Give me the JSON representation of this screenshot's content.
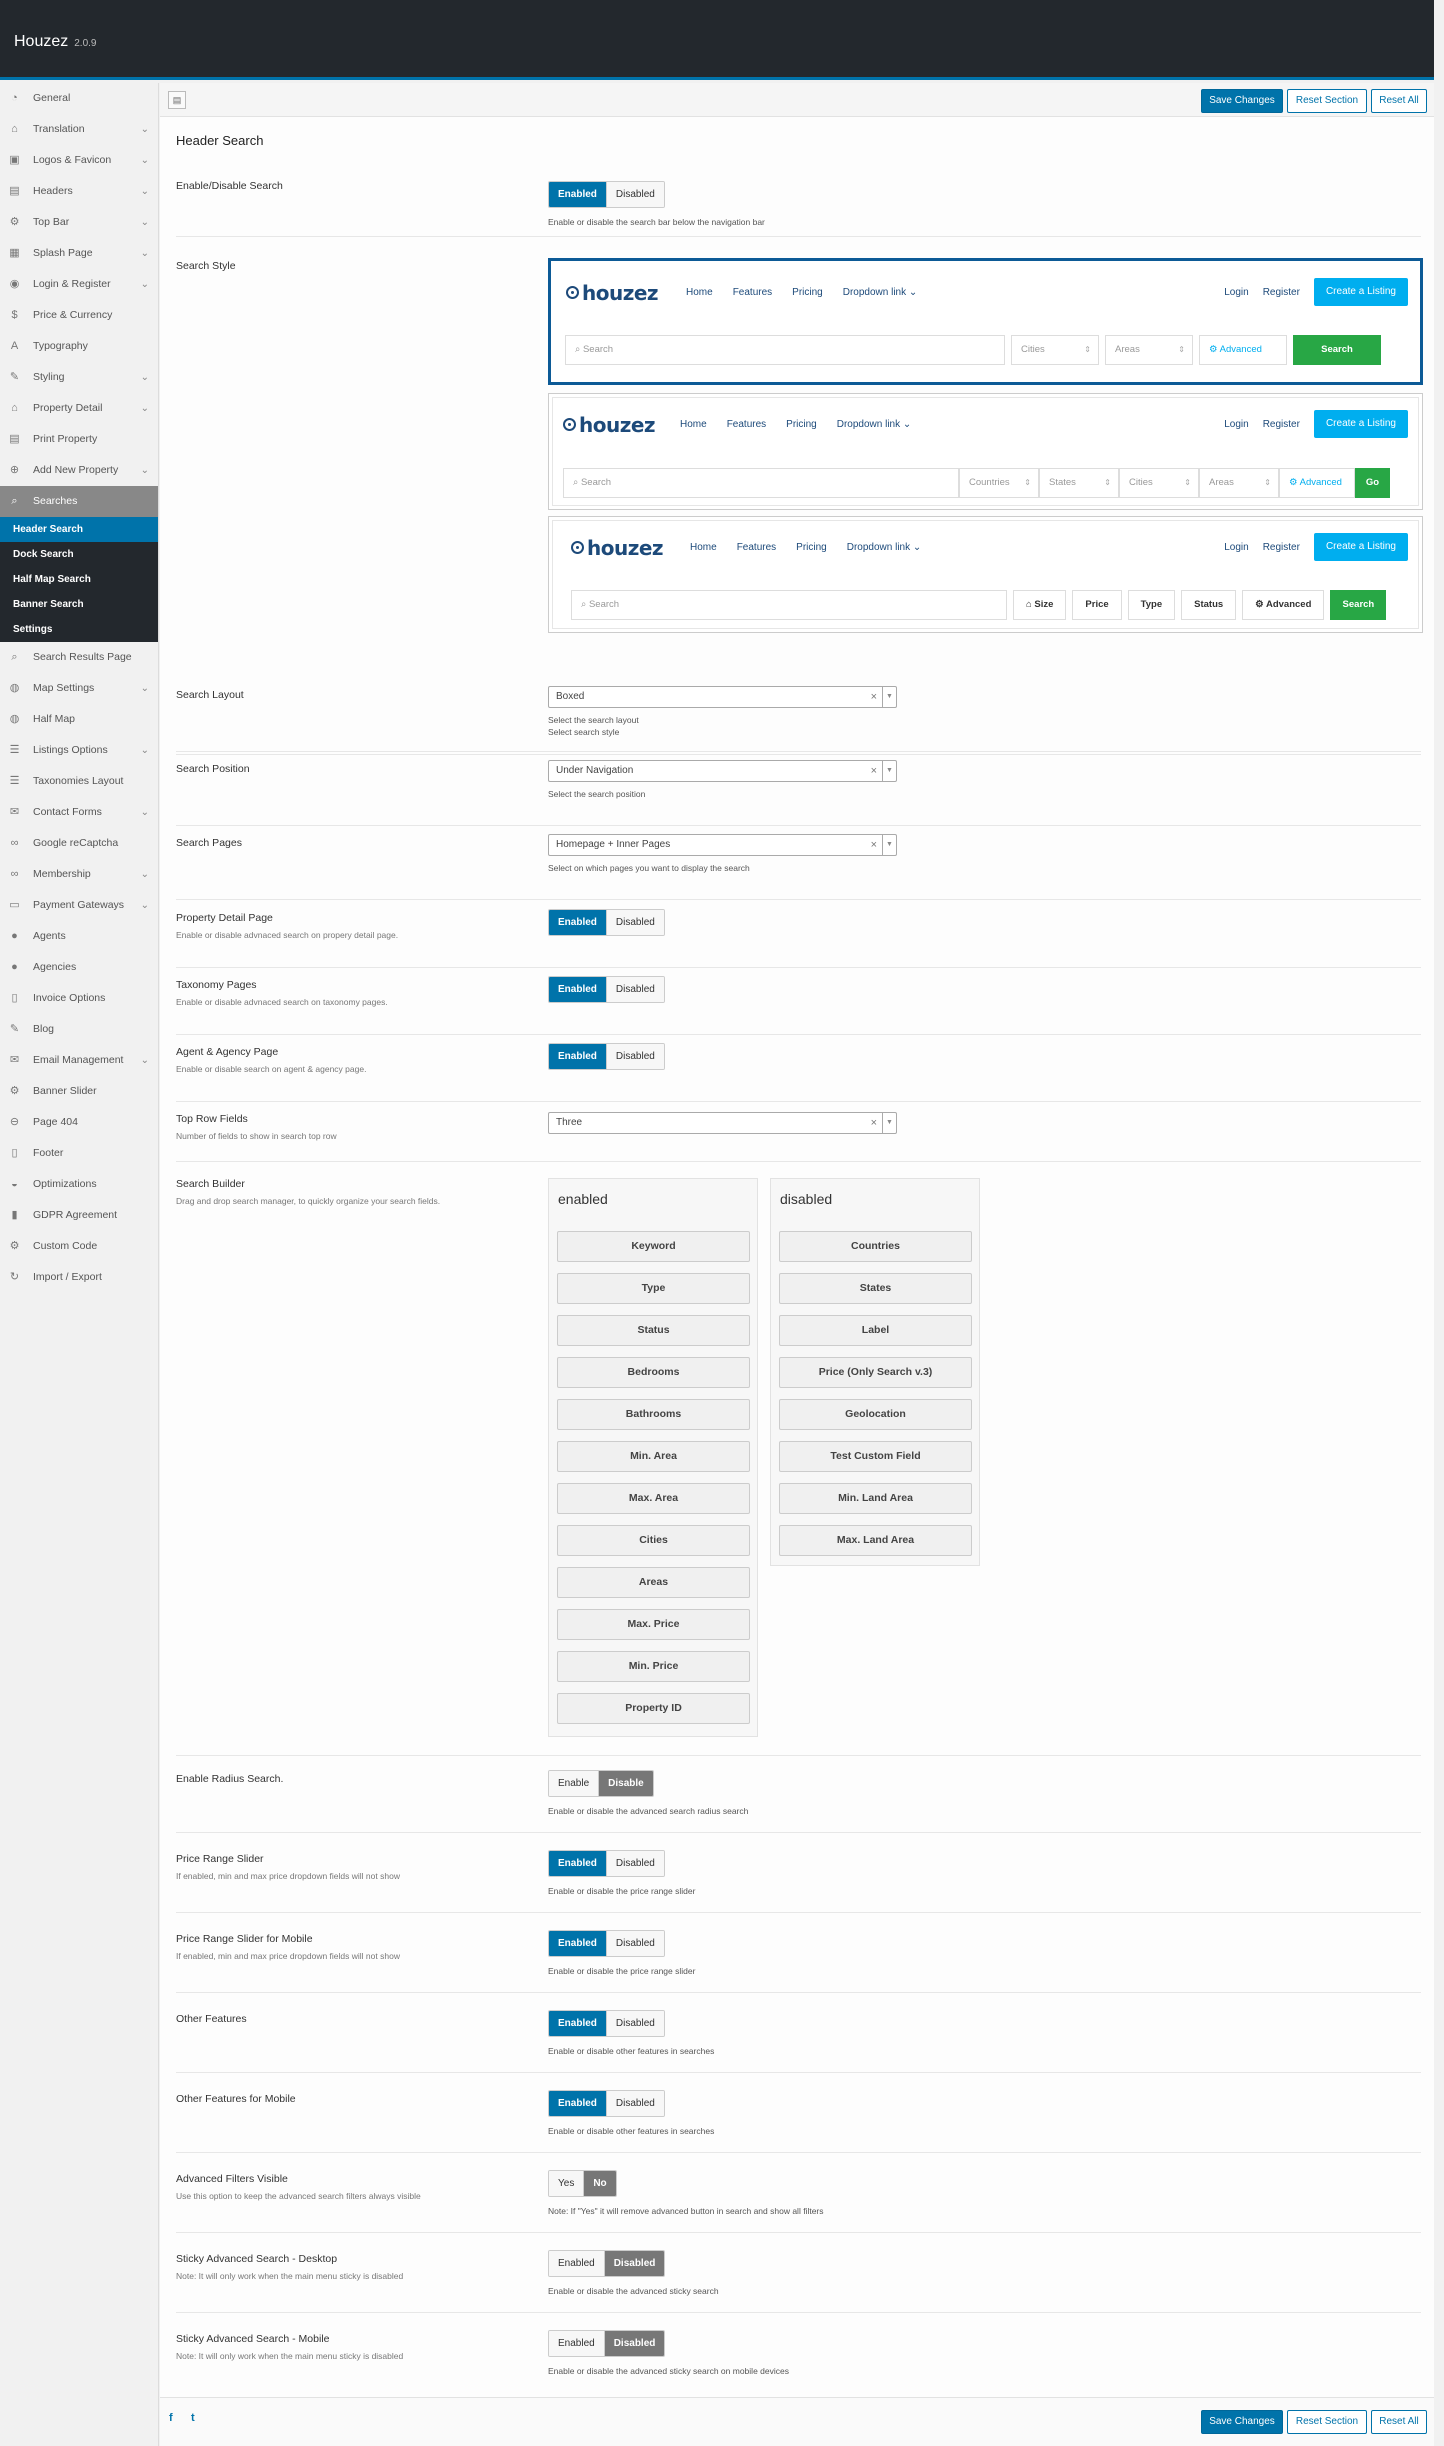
{
  "app": {
    "name": "Houzez",
    "version": "2.0.9"
  },
  "actions": {
    "save": "Save Changes",
    "reset_section": "Reset Section",
    "reset_all": "Reset All"
  },
  "sidebar": {
    "items": [
      {
        "label": "General",
        "icon": "dashboard-icon",
        "chev": false
      },
      {
        "label": "Translation",
        "icon": "home-icon",
        "chev": true
      },
      {
        "label": "Logos & Favicon",
        "icon": "image-icon",
        "chev": true
      },
      {
        "label": "Headers",
        "icon": "header-icon",
        "chev": true
      },
      {
        "label": "Top Bar",
        "icon": "gear-icon",
        "chev": true
      },
      {
        "label": "Splash Page",
        "icon": "layout-icon",
        "chev": true
      },
      {
        "label": "Login & Register",
        "icon": "user-circle-icon",
        "chev": true
      },
      {
        "label": "Price & Currency",
        "icon": "dollar-icon",
        "chev": false
      },
      {
        "label": "Typography",
        "icon": "font-icon",
        "chev": false
      },
      {
        "label": "Styling",
        "icon": "brush-icon",
        "chev": true
      },
      {
        "label": "Property Detail",
        "icon": "home-icon",
        "chev": true
      },
      {
        "label": "Print Property",
        "icon": "print-icon",
        "chev": false
      },
      {
        "label": "Add New Property",
        "icon": "plus-circle-icon",
        "chev": true
      },
      {
        "label": "Searches",
        "icon": "search-icon",
        "chev": false,
        "active": true
      }
    ],
    "sub_items": [
      "Header Search",
      "Dock Search",
      "Half Map Search",
      "Banner Search",
      "Settings"
    ],
    "items_after": [
      {
        "label": "Search Results Page",
        "icon": "search-icon",
        "chev": false
      },
      {
        "label": "Map Settings",
        "icon": "globe-icon",
        "chev": true
      },
      {
        "label": "Half Map",
        "icon": "globe-icon",
        "chev": false
      },
      {
        "label": "Listings Options",
        "icon": "list-icon",
        "chev": true
      },
      {
        "label": "Taxonomies Layout",
        "icon": "list-icon",
        "chev": false
      },
      {
        "label": "Contact Forms",
        "icon": "envelope-icon",
        "chev": true
      },
      {
        "label": "Google reCaptcha",
        "icon": "link-icon",
        "chev": false
      },
      {
        "label": "Membership",
        "icon": "link-icon",
        "chev": true
      },
      {
        "label": "Payment Gateways",
        "icon": "card-icon",
        "chev": true
      },
      {
        "label": "Agents",
        "icon": "user-icon",
        "chev": false
      },
      {
        "label": "Agencies",
        "icon": "user-icon",
        "chev": false
      },
      {
        "label": "Invoice Options",
        "icon": "document-icon",
        "chev": false
      },
      {
        "label": "Blog",
        "icon": "edit-icon",
        "chev": false
      },
      {
        "label": "Email Management",
        "icon": "envelope-icon",
        "chev": true
      },
      {
        "label": "Banner Slider",
        "icon": "gear-icon",
        "chev": false
      },
      {
        "label": "Page 404",
        "icon": "minus-circle-icon",
        "chev": false
      },
      {
        "label": "Footer",
        "icon": "document-icon",
        "chev": false
      },
      {
        "label": "Optimizations",
        "icon": "gauge-icon",
        "chev": false
      },
      {
        "label": "GDPR Agreement",
        "icon": "bookmark-icon",
        "chev": false
      },
      {
        "label": "Custom Code",
        "icon": "gear-icon",
        "chev": false
      },
      {
        "label": "Import / Export",
        "icon": "refresh-icon",
        "chev": false
      }
    ]
  },
  "page": {
    "title": "Header Search"
  },
  "fields": {
    "enable_search": {
      "label": "Enable/Disable Search",
      "on": "Enabled",
      "off": "Disabled",
      "desc": "Enable or disable the search bar below the navigation bar"
    },
    "search_style": {
      "label": "Search Style",
      "desc": "Select search style"
    },
    "search_layout": {
      "label": "Search Layout",
      "value": "Boxed",
      "desc": "Select the search layout"
    },
    "search_position": {
      "label": "Search Position",
      "value": "Under Navigation",
      "desc": "Select the search position"
    },
    "search_pages": {
      "label": "Search Pages",
      "value": "Homepage + Inner Pages",
      "desc": "Select on which pages you want to display the search"
    },
    "property_detail": {
      "label": "Property Detail Page",
      "sub": "Enable or disable advnaced search on propery detail page.",
      "on": "Enabled",
      "off": "Disabled"
    },
    "taxonomy": {
      "label": "Taxonomy Pages",
      "sub": "Enable or disable advnaced search on taxonomy pages.",
      "on": "Enabled",
      "off": "Disabled"
    },
    "agent_agency": {
      "label": "Agent & Agency Page",
      "sub": "Enable or disable search on agent & agency page.",
      "on": "Enabled",
      "off": "Disabled"
    },
    "top_row": {
      "label": "Top Row Fields",
      "sub": "Number of fields to show in search top row",
      "value": "Three"
    },
    "builder": {
      "label": "Search Builder",
      "sub": "Drag and drop search manager, to quickly organize your search fields."
    },
    "radius": {
      "label": "Enable Radius Search.",
      "on": "Enable",
      "off": "Disable",
      "desc": "Enable or disable the advanced search radius search"
    },
    "price_slider": {
      "label": "Price Range Slider",
      "sub": "If enabled, min and max price dropdown fields will not show",
      "on": "Enabled",
      "off": "Disabled",
      "desc": "Enable or disable the price range slider"
    },
    "price_slider_mobile": {
      "label": "Price Range Slider for Mobile",
      "sub": "If enabled, min and max price dropdown fields will not show",
      "on": "Enabled",
      "off": "Disabled",
      "desc": "Enable or disable the price range slider"
    },
    "other_features": {
      "label": "Other Features",
      "on": "Enabled",
      "off": "Disabled",
      "desc": "Enable or disable other features in searches"
    },
    "other_features_mobile": {
      "label": "Other Features for Mobile",
      "on": "Enabled",
      "off": "Disabled",
      "desc": "Enable or disable other features in searches"
    },
    "adv_filters": {
      "label": "Advanced Filters Visible",
      "sub": "Use this option to keep the advanced search filters always visible",
      "on": "Yes",
      "off": "No",
      "desc": "Note: If \"Yes\" it will remove advanced button in search and show all filters"
    },
    "sticky_desktop": {
      "label": "Sticky Advanced Search - Desktop",
      "sub": "Note: It will only work when the main menu sticky is disabled",
      "on": "Enabled",
      "off": "Disabled",
      "desc": "Enable or disable the advanced sticky search"
    },
    "sticky_mobile": {
      "label": "Sticky Advanced Search - Mobile",
      "sub": "Note: It will only work when the main menu sticky is disabled",
      "on": "Enabled",
      "off": "Disabled",
      "desc": "Enable or disable the advanced sticky search on mobile devices"
    }
  },
  "preview": {
    "logo": "houzez",
    "nav": [
      "Home",
      "Features",
      "Pricing",
      "Dropdown link"
    ],
    "login": "Login",
    "register": "Register",
    "create": "Create a Listing",
    "search_placeholder": "Search",
    "s1": {
      "fields": [
        "Cities",
        "Areas"
      ],
      "advanced": "Advanced",
      "button": "Search"
    },
    "s2": {
      "fields": [
        "Countries",
        "States",
        "Cities",
        "Areas"
      ],
      "advanced": "Advanced",
      "button": "Go"
    },
    "s3": {
      "chips": [
        "Size",
        "Price",
        "Type",
        "Status",
        "Advanced"
      ],
      "button": "Search"
    }
  },
  "builder": {
    "enabled_title": "enabled",
    "disabled_title": "disabled",
    "enabled": [
      "Keyword",
      "Type",
      "Status",
      "Bedrooms",
      "Bathrooms",
      "Min. Area",
      "Max. Area",
      "Cities",
      "Areas",
      "Max. Price",
      "Min. Price",
      "Property ID"
    ],
    "disabled": [
      "Countries",
      "States",
      "Label",
      "Price (Only Search v.3)",
      "Geolocation",
      "Test Custom Field",
      "Min. Land Area",
      "Max. Land Area"
    ]
  },
  "footer": {
    "facebook": "f",
    "twitter": "t"
  },
  "colors": {
    "accent": "#0073aa",
    "topbar": "#23282d",
    "green": "#28a745",
    "cyan": "#00aeef"
  }
}
